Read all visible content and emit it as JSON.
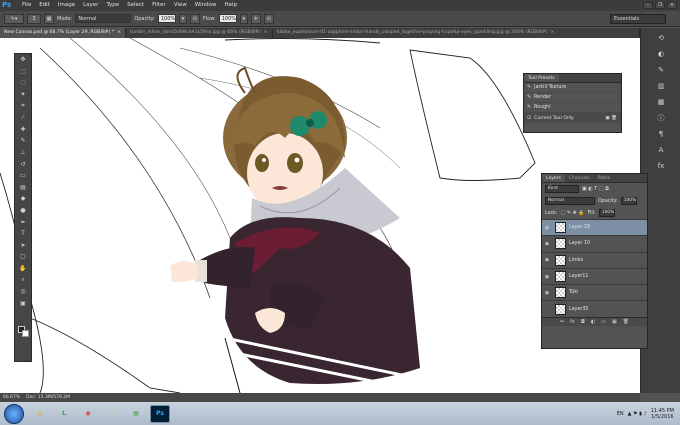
{
  "app": {
    "logo": "Ps"
  },
  "menu": [
    "File",
    "Edit",
    "Image",
    "Layer",
    "Type",
    "Select",
    "Filter",
    "View",
    "Window",
    "Help"
  ],
  "window_controls": [
    "–",
    "❐",
    "✕"
  ],
  "options": {
    "brush_size": "3",
    "mode_label": "Mode:",
    "mode_value": "Normal",
    "opacity_label": "Opacity:",
    "opacity_value": "100%",
    "flow_label": "Flow:",
    "flow_value": "100%",
    "workspace": "Essentials"
  },
  "tabs": [
    {
      "label": "New Canvas.psd @ 66.7% (Layer 29, RGB/8#) *",
      "active": true
    },
    {
      "label": "tumblr_inline_nbmi5r6WceA1s59ns.jpg @ 66% (RGB/8#)",
      "active": false
    },
    {
      "label": "hibike_euphonium-01-sapphire-midori-hands_clasped_together-praying-hopeful-eyes_sparkling.jpg @ 200% (RGB/8#)",
      "active": false
    }
  ],
  "tool_presets": {
    "title": "Tool Presets",
    "items": [
      "Jarkill Texture",
      "Render",
      "Roughl"
    ],
    "footer": "Current Tool Only"
  },
  "layers_panel": {
    "tabs": [
      "Layers",
      "Channels",
      "Paths"
    ],
    "kind": "Kind",
    "blend_mode": "Normal",
    "opacity_label": "Opacity:",
    "opacity_value": "100%",
    "lock_label": "Lock:",
    "fill_label": "Fill:",
    "fill_value": "100%",
    "layers": [
      {
        "name": "Layer 29",
        "selected": true,
        "visible": true
      },
      {
        "name": "Layer 10",
        "selected": false,
        "visible": true
      },
      {
        "name": "Limbs",
        "selected": false,
        "visible": true
      },
      {
        "name": "Layer11",
        "selected": false,
        "visible": true
      },
      {
        "name": "Tüki",
        "selected": false,
        "visible": true
      },
      {
        "name": "Layer35",
        "selected": false,
        "visible": false
      }
    ]
  },
  "status": {
    "zoom": "66.67%",
    "doc": "Doc: 13.3M/578.2M"
  },
  "taskbar": {
    "apps": [
      {
        "name": "Windows Explorer",
        "glyph": "▤",
        "color": "#e0b44a"
      },
      {
        "name": "LINE",
        "glyph": "L",
        "color": "#19b23a"
      },
      {
        "name": "Chrome",
        "glyph": "◉",
        "color": "#d9433a"
      },
      {
        "name": "Folder",
        "glyph": "▭",
        "color": "#e8c35a"
      },
      {
        "name": "Games",
        "glyph": "▦",
        "color": "#5aa84e"
      },
      {
        "name": "Photoshop",
        "glyph": "Ps",
        "color": "#31a8ff"
      }
    ],
    "lang": "EN",
    "time": "11:45 PM",
    "date": "1/5/2016"
  },
  "colors": {
    "foreground": "#2d1d13",
    "background": "#ffffff",
    "accent_selected": "#7d8fa5"
  }
}
